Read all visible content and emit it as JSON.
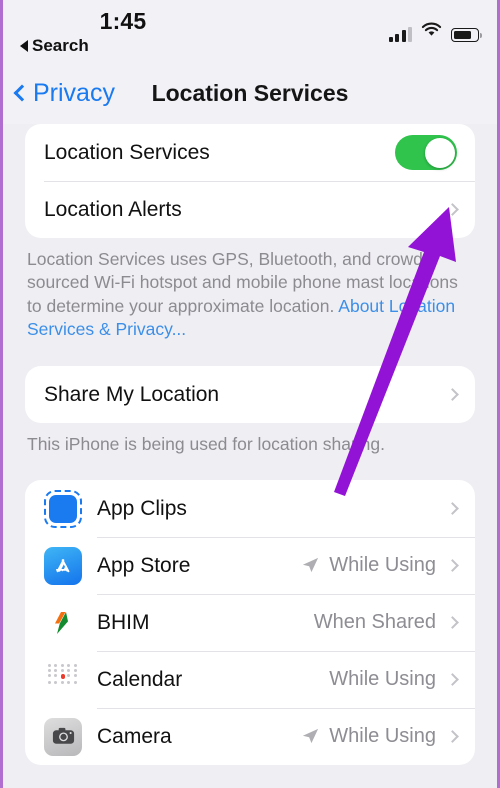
{
  "status_bar": {
    "time": "1:45",
    "back_app": "Search",
    "icons": [
      "signal-bars-icon",
      "wifi-icon",
      "battery-icon"
    ],
    "battery_level": "75"
  },
  "nav": {
    "back_label": "Privacy",
    "title": "Location Services"
  },
  "colors": {
    "toggle_on": "#30c44d",
    "link_blue": "#3b8fe8",
    "tint_blue": "#1a7af0",
    "annotation_purple": "#9213d6",
    "page_background": "#efeef3"
  },
  "section_main": {
    "rows": [
      {
        "label": "Location Services",
        "control": "toggle",
        "value": "on"
      },
      {
        "label": "Location Alerts",
        "control": "chevron",
        "value": ""
      }
    ],
    "footer_text": "Location Services uses GPS, Bluetooth, and crowd-sourced Wi-Fi hotspot and mobile phone mast locations to determine your approximate location. ",
    "footer_link": "About Location Services & Privacy..."
  },
  "section_share": {
    "rows": [
      {
        "label": "Share My Location",
        "control": "chevron",
        "value": ""
      }
    ],
    "footer_text": "This iPhone is being used for location sharing."
  },
  "section_apps": {
    "rows": [
      {
        "label": "App Clips",
        "value": "",
        "icon": "app-clips-icon",
        "arrow": false
      },
      {
        "label": "App Store",
        "value": "While Using",
        "icon": "app-store-icon",
        "arrow": true
      },
      {
        "label": "BHIM",
        "value": "When Shared",
        "icon": "bhim-icon",
        "arrow": false
      },
      {
        "label": "Calendar",
        "value": "While Using",
        "icon": "calendar-icon",
        "arrow": false
      },
      {
        "label": "Camera",
        "value": "While Using",
        "icon": "camera-icon",
        "arrow": true
      }
    ]
  },
  "annotation": {
    "type": "arrow",
    "points_to": "location-services-toggle",
    "color": "#9213d6"
  }
}
